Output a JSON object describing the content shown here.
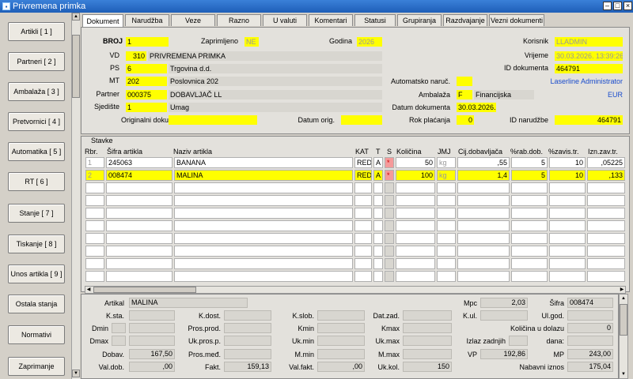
{
  "window": {
    "title": "Privremena primka"
  },
  "sidebar": {
    "items": [
      {
        "label": "Artikli [ 1 ]"
      },
      {
        "label": "Partneri [ 2 ]"
      },
      {
        "label": "Ambalaža [ 3 ]"
      },
      {
        "label": "Pretvornici [ 4 ]"
      },
      {
        "label": "Automatika [ 5 ]"
      },
      {
        "label": "RT [ 6 ]"
      },
      {
        "label": "Stanje [ 7 ]"
      },
      {
        "label": "Tiskanje [ 8 ]"
      },
      {
        "label": "Unos artikla [ 9 ]"
      },
      {
        "label": "Ostala stanja"
      },
      {
        "label": "Normativi"
      },
      {
        "label": "Zaprimanje"
      }
    ]
  },
  "tabs": [
    "Dokument",
    "Narudžba",
    "Veze",
    "Razno",
    "U valuti",
    "Komentari",
    "Statusi",
    "Grupiranja",
    "Razdvajanje",
    "Vezni dokumenti"
  ],
  "header": {
    "broj_label": "BROJ",
    "broj": "1",
    "zaprimljeno_label": "Zaprimljeno",
    "zaprimljeno": "NE",
    "godina_label": "Godina",
    "godina": "2026",
    "korisnik_label": "Korisnik",
    "korisnik": "LLADMIN",
    "vd_label": "VD",
    "vd_code": "310",
    "vd_name": "PRIVREMENA PRIMKA",
    "vrijeme_label": "Vrijeme",
    "vrijeme": "30.03.2026. 13:39:26",
    "ps_label": "PS",
    "ps_code": "6",
    "ps_name": "Trgovina d.d.",
    "id_dok_label": "ID dokumenta",
    "id_dok": "464791",
    "mt_label": "MT",
    "mt_code": "202",
    "mt_name": "Poslovnica 202",
    "auto_naruc_label": "Automatsko naruč.",
    "auto_naruc": "",
    "laserline_text": "Laserline Administrator",
    "partner_label": "Partner",
    "partner_code": "000375",
    "partner_name": "DOBAVLJAČ LL",
    "ambalaza_label": "Ambalaža",
    "ambalaza_code": "F",
    "ambalaza_name": "Financijska",
    "currency": "EUR",
    "sjediste_label": "Sjedište",
    "sjediste_code": "1",
    "sjediste_name": "Umag",
    "datum_dok_label": "Datum dokumenta",
    "datum_dok": "30.03.2026.",
    "orig_dok_label": "Originalni dokument",
    "orig_dok": "",
    "datum_orig_label": "Datum orig.",
    "datum_orig": "",
    "rok_label": "Rok plaćanja",
    "rok": "0",
    "id_nar_label": "ID narudžbe",
    "id_nar": "464791"
  },
  "stavke": {
    "title": "Stavke",
    "columns": [
      "Rbr.",
      "Šifra artikla",
      "Naziv artikla",
      "KAT",
      "T",
      "S",
      "Količina",
      "JMJ",
      "Cij.dobavljača",
      "%rab.dob.",
      "%zavis.tr.",
      "Izn.zav.tr."
    ],
    "rows": [
      {
        "rbr": "1",
        "sifra": "245063",
        "naziv": "BANANA",
        "kat": "RED",
        "t": "A",
        "s": "*",
        "kol": "50",
        "jmj": "kg",
        "cij": ",55",
        "rab": "5",
        "zav": "10",
        "izn": ",05225"
      },
      {
        "rbr": "2",
        "sifra": "008474",
        "naziv": "MALINA",
        "kat": "RED",
        "t": "A",
        "s": "*",
        "kol": "100",
        "jmj": "kg",
        "cij": "1,4",
        "rab": "5",
        "zav": "10",
        "izn": ",133"
      }
    ]
  },
  "details": {
    "artikal_label": "Artikal",
    "artikal": "MALINA",
    "mpc_label": "Mpc",
    "mpc": "2,03",
    "sifra_label": "Šifra",
    "sifra": "008474",
    "ksta_label": "K.sta.",
    "kdost_label": "K.dost.",
    "kslob_label": "K.slob.",
    "datzad_label": "Dat.zad.",
    "kul_label": "K.ul.",
    "ulgod_label": "Ul.god.",
    "dmin_label": "Dmin",
    "prosprod_label": "Pros.prod.",
    "kmin_label": "Kmin",
    "kmax_label": "Kmax",
    "kol_dolazu_label": "Količina u dolazu",
    "kol_dolazu": "0",
    "dmax_label": "Dmax",
    "ukprosp_label": "Uk.pros.p.",
    "ukmin_label": "Uk.min",
    "ukmax_label": "Uk.max",
    "izlaz_label": "Izlaz zadnjih",
    "dana_label": "dana:",
    "dobav_label": "Dobav.",
    "dobav": "167,50",
    "prosmed_label": "Pros.međ.",
    "mmin_label": "M.min",
    "mmax_label": "M.max",
    "vp_label": "VP",
    "vp": "192,86",
    "mp_label": "MP",
    "mp": "243,00",
    "valdob_label": "Val.dob.",
    "valdob": ",00",
    "fakt_label": "Fakt.",
    "fakt": "159,13",
    "valfakt_label": "Val.fakt.",
    "valfakt": ",00",
    "ukkol_label": "Uk.kol.",
    "ukkol": "150",
    "nabavni_label": "Nabavni iznos",
    "nabavni": "175,04"
  }
}
